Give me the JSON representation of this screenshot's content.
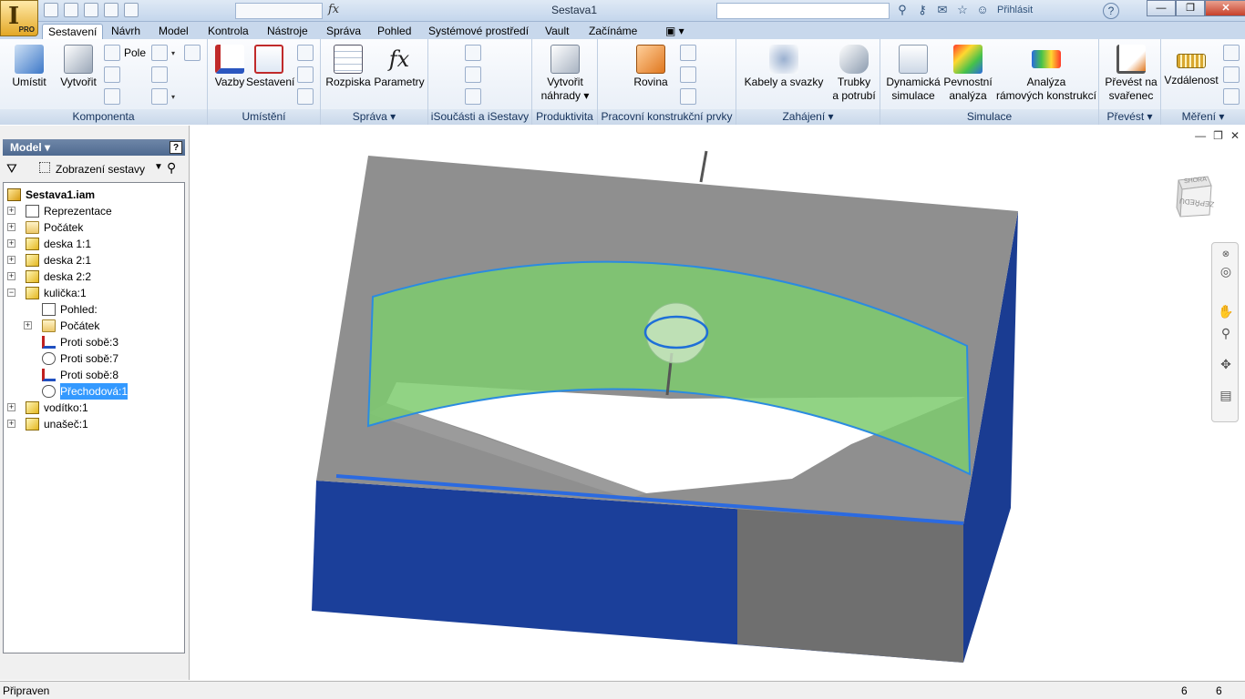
{
  "app": {
    "logo_glyph": "I",
    "edition": "PRO",
    "title": "Sestava1",
    "sign_in": "Přihlásit",
    "help": "?"
  },
  "window_buttons": {
    "minimize": "—",
    "maximize": "❐",
    "close": "✕"
  },
  "qat": {
    "fx": "fx"
  },
  "tabs": [
    {
      "label": "Sestavení",
      "active": true
    },
    {
      "label": "Návrh"
    },
    {
      "label": "Model"
    },
    {
      "label": "Kontrola"
    },
    {
      "label": "Nástroje"
    },
    {
      "label": "Správa"
    },
    {
      "label": "Pohled"
    },
    {
      "label": "Systémové prostředí"
    },
    {
      "label": "Vault"
    },
    {
      "label": "Začínáme"
    },
    {
      "label": "▣ ▾"
    }
  ],
  "ribbon": {
    "komponenta": {
      "title": "Komponenta",
      "umistit": "Umístit",
      "vytvorit": "Vytvořit",
      "pole": "Pole",
      "dd_arrow": "▾"
    },
    "umisteni": {
      "title": "Umístění",
      "vazby": "Vazby",
      "sestaveni": "Sestavení"
    },
    "sprava": {
      "title": "Správa ▾",
      "rozpiska": "Rozpiska",
      "parametry": "Parametry",
      "fx": "fx"
    },
    "isoucasti": {
      "title": "iSoučásti a iSestavy"
    },
    "produktivita": {
      "title": "Produktivita",
      "vytvorit_nahrady_1": "Vytvořit",
      "vytvorit_nahrady_2": "náhrady ▾"
    },
    "pracovni": {
      "title": "Pracovní konstrukční prvky",
      "rovina": "Rovina"
    },
    "zahajeni": {
      "title": "Zahájení ▾",
      "kabely": "Kabely a svazky",
      "trubky_1": "Trubky",
      "trubky_2": "a potrubí"
    },
    "simulace": {
      "title": "Simulace",
      "dyn_1": "Dynamická",
      "dyn_2": "simulace",
      "pev_1": "Pevnostní",
      "pev_2": "analýza",
      "ram_1": "Analýza",
      "ram_2": "rámových konstrukcí"
    },
    "prevest": {
      "title": "Převést ▾",
      "svarenec_1": "Převést na",
      "svarenec_2": "svařenec"
    },
    "mereni": {
      "title": "Měření ▾",
      "vzdalenost": "Vzdálenost"
    }
  },
  "browser": {
    "title": "Model ▾",
    "help": "?",
    "filter_icon": "funnel-icon",
    "view_label": "Zobrazení sestavy",
    "dropdown": "▼",
    "find_icon": "binoculars-icon",
    "tree": [
      {
        "label": "Sestava1.iam",
        "icon": "assembly",
        "level": 0,
        "expander": "",
        "bold": true
      },
      {
        "label": "Reprezentace",
        "icon": "rep",
        "level": 0,
        "expander": "+"
      },
      {
        "label": "Počátek",
        "icon": "folder",
        "level": 0,
        "expander": "+"
      },
      {
        "label": "deska 1:1",
        "icon": "part",
        "level": 0,
        "expander": "+"
      },
      {
        "label": "deska 2:1",
        "icon": "part",
        "level": 0,
        "expander": "+"
      },
      {
        "label": "deska 2:2",
        "icon": "part",
        "level": 0,
        "expander": "+"
      },
      {
        "label": "kulička:1",
        "icon": "part",
        "level": 0,
        "expander": "−"
      },
      {
        "label": "Pohled:",
        "icon": "rep",
        "level": 1,
        "expander": ""
      },
      {
        "label": "Počátek",
        "icon": "folder",
        "level": 1,
        "expander": "+"
      },
      {
        "label": "Proti sobě:3",
        "icon": "constraint",
        "level": 1,
        "expander": ""
      },
      {
        "label": "Proti sobě:7",
        "icon": "tang",
        "level": 1,
        "expander": ""
      },
      {
        "label": "Proti sobě:8",
        "icon": "constraint",
        "level": 1,
        "expander": ""
      },
      {
        "label": "Přechodová:1",
        "icon": "tang",
        "level": 1,
        "expander": "",
        "selected": true
      },
      {
        "label": "vodítko:1",
        "icon": "part",
        "level": 0,
        "expander": "+"
      },
      {
        "label": "unašeč:1",
        "icon": "part",
        "level": 0,
        "expander": "+"
      }
    ]
  },
  "viewcube": {
    "top": "SHORA",
    "front": "ZEPŘEDU"
  },
  "doc_controls": {
    "minimize": "—",
    "restore": "❐",
    "close": "✕"
  },
  "status": {
    "text": "Připraven",
    "n1": "6",
    "n2": "6"
  },
  "colors": {
    "plate_gray": "#8c8c8c",
    "plate_top": "#9a9a9a",
    "blue_face": "#1b3f9a",
    "surface_green": "#7ecb6e",
    "edge_blue": "#2b8be0"
  }
}
